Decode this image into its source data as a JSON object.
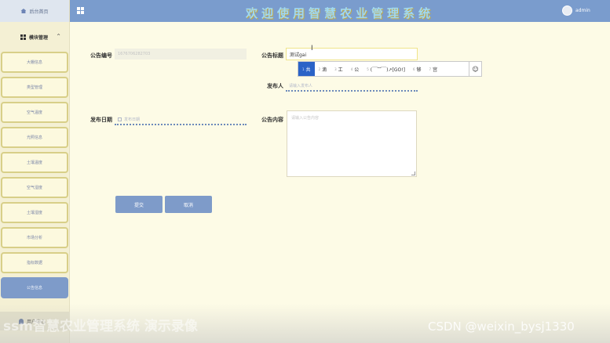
{
  "sidebar": {
    "home_label": "后台首页",
    "module_label": "模块管理",
    "items": [
      {
        "label": "大棚信息"
      },
      {
        "label": "类型管理"
      },
      {
        "label": "空气温度"
      },
      {
        "label": "光照信息"
      },
      {
        "label": "土壤温度"
      },
      {
        "label": "空气湿度"
      },
      {
        "label": "土壤湿度"
      },
      {
        "label": "市场分析"
      },
      {
        "label": "指标数据"
      },
      {
        "label": "公告信息",
        "active": true
      }
    ],
    "user_label": "用户中心"
  },
  "header": {
    "title": "欢迎使用智慧农业管理系统",
    "username": "admin"
  },
  "form": {
    "notice_no": {
      "label": "公告编号",
      "value": "1676706282703"
    },
    "notice_title": {
      "label": "公告标题",
      "value": "测试gai"
    },
    "publisher": {
      "label": "发布人",
      "placeholder": "请输入发布人"
    },
    "publish_date": {
      "label": "发布日期",
      "placeholder": "发布日期"
    },
    "content": {
      "label": "公告内容",
      "placeholder": "请输入公告内容"
    },
    "submit_label": "提交",
    "cancel_label": "取消"
  },
  "ime": {
    "candidates": [
      {
        "n": "1",
        "text": "共",
        "selected": true
      },
      {
        "n": "2",
        "text": "滴"
      },
      {
        "n": "3",
        "text": "工"
      },
      {
        "n": "4",
        "text": "公"
      },
      {
        "n": "5",
        "text": "(￣︶￣)↗[GO!]"
      },
      {
        "n": "6",
        "text": "够"
      },
      {
        "n": "7",
        "text": "宫"
      }
    ],
    "emoji": "☺"
  },
  "watermarks": {
    "left": "ssm智慧农业管理系统 演示录像",
    "right": "CSDN @weixin_bysj1330"
  }
}
